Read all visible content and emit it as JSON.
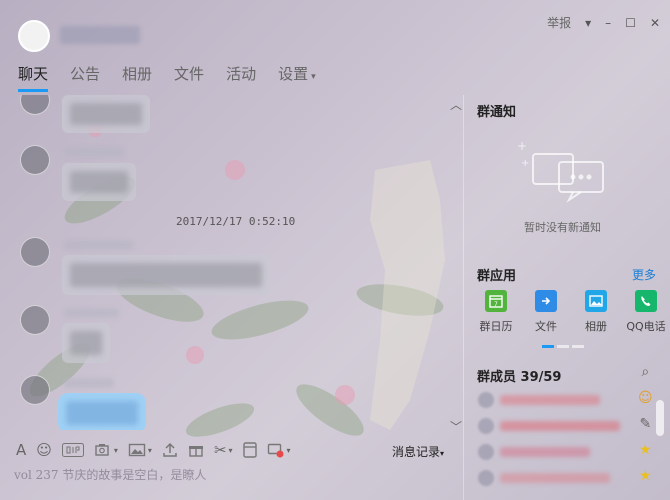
{
  "window": {
    "report_label": "举报",
    "minimize": "–",
    "maximize": "☐",
    "close": "✕"
  },
  "tabs": [
    {
      "label": "聊天",
      "active": true
    },
    {
      "label": "公告"
    },
    {
      "label": "相册"
    },
    {
      "label": "文件"
    },
    {
      "label": "活动"
    },
    {
      "label": "设置",
      "has_dropdown": true
    }
  ],
  "chat": {
    "timestamp": "2017/12/17 0:52:10"
  },
  "toolbar": {
    "icons": [
      "font-icon",
      "emoji-icon",
      "gif-icon",
      "screenshot-icon",
      "image-icon",
      "upload-icon",
      "gift-icon",
      "scissors-icon",
      "red-packet-icon",
      "shake-icon"
    ],
    "history_label": "消息记录"
  },
  "input": {
    "text": "vol 237 节庆的故事是空白，是瞭人"
  },
  "group_notice": {
    "title": "群通知",
    "empty_text": "暂时没有新通知"
  },
  "group_apps": {
    "title": "群应用",
    "more_label": "更多",
    "items": [
      {
        "label": "群日历",
        "color": "#52b43d"
      },
      {
        "label": "文件",
        "color": "#2f8ce6"
      },
      {
        "label": "相册",
        "color": "#21a6e8"
      },
      {
        "label": "QQ电话",
        "color": "#17b66d"
      }
    ]
  },
  "members": {
    "title": "群成员 39/59"
  },
  "colors": {
    "accent": "#1a9af5",
    "link": "#1a7fd6",
    "self_bubble": "#9fd0f5"
  }
}
